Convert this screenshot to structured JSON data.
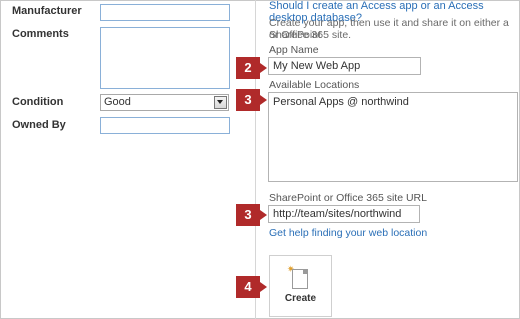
{
  "form": {
    "manufacturer_label": "Manufacturer",
    "comments_label": "Comments",
    "condition_label": "Condition",
    "condition_value": "Good",
    "owned_by_label": "Owned By"
  },
  "panel": {
    "question_link": "Should I create an Access app or an Access desktop database?",
    "description_line1": "Create your app, then use it and share it on either a SharePoint",
    "description_line2": "or Office 365 site.",
    "app_name_label": "App Name",
    "app_name_value": "My New Web App",
    "locations_label": "Available Locations",
    "locations_item": "Personal Apps @ northwind",
    "url_label": "SharePoint or Office 365 site URL",
    "url_value": "http://team/sites/northwind",
    "help_link": "Get help finding your web location",
    "create_label": "Create"
  },
  "callouts": {
    "app_name": "2",
    "locations": "3",
    "url": "3",
    "create": "4"
  },
  "colors": {
    "link": "#2a6fb7",
    "callout": "#b02a2a",
    "field_border": "#8ab0d8"
  }
}
